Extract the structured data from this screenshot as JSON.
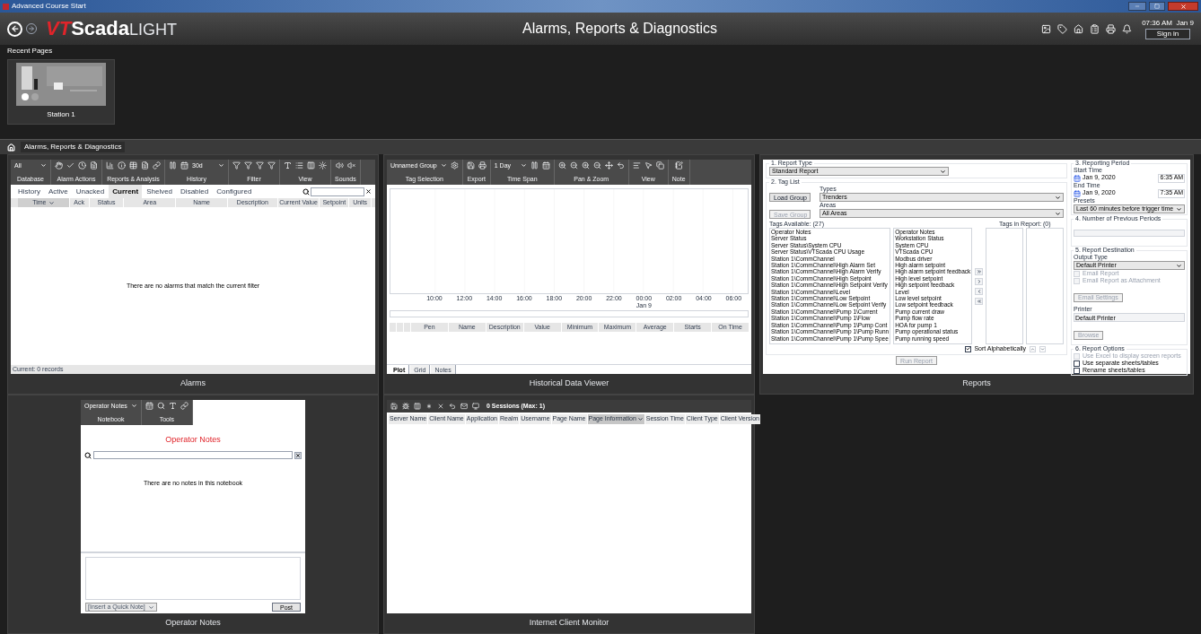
{
  "window": {
    "title": "Advanced Course Start"
  },
  "header": {
    "logo": {
      "brand_red": "VT",
      "brand": "Scada",
      "edition": "LIGHT"
    },
    "title": "Alarms, Reports & Diagnostics",
    "clock": "07:36 AM  Jan 9",
    "sign_in": "Sign in"
  },
  "recent_pages": {
    "title": "Recent Pages",
    "items": [
      {
        "label": "Station 1"
      }
    ]
  },
  "breadcrumb": [
    "Alarms, Reports & Diagnostics"
  ],
  "alarms": {
    "caption": "Alarms",
    "toolbar": [
      {
        "label": "Database",
        "select": "All"
      },
      {
        "label": "Alarm Actions"
      },
      {
        "label": "Reports & Analysis"
      },
      {
        "label": "History",
        "select": "30d"
      },
      {
        "label": "Filter"
      },
      {
        "label": "View"
      },
      {
        "label": "Sounds"
      }
    ],
    "tabs": [
      {
        "label": "History",
        "selected": false
      },
      {
        "label": "Active",
        "selected": false
      },
      {
        "label": "Unacked",
        "selected": false
      },
      {
        "label": "Current",
        "selected": true
      },
      {
        "label": "Shelved",
        "selected": false
      },
      {
        "label": "Disabled",
        "selected": false
      },
      {
        "label": "Configured",
        "selected": false
      }
    ],
    "columns": [
      {
        "label": "Time",
        "sorted": true
      },
      {
        "label": "Ack",
        "sorted": false
      },
      {
        "label": "Status",
        "sorted": false
      },
      {
        "label": "Area",
        "sorted": false
      },
      {
        "label": "Name",
        "sorted": false
      },
      {
        "label": "Description",
        "sorted": false
      },
      {
        "label": "Current Value",
        "sorted": false
      },
      {
        "label": "Setpoint",
        "sorted": false
      },
      {
        "label": "Units",
        "sorted": false
      }
    ],
    "empty_message": "There are no alarms that match the current filter",
    "status": "Current: 0 records"
  },
  "historical": {
    "caption": "Historical Data Viewer",
    "toolbar": [
      {
        "label": "Tag Selection",
        "select": "Unnamed Group"
      },
      {
        "label": "Export"
      },
      {
        "label": "Time Span",
        "select": "1 Day"
      },
      {
        "label": "Pan & Zoom"
      },
      {
        "label": "View"
      },
      {
        "label": "Note"
      }
    ],
    "x_ticks": [
      {
        "label": "10:00"
      },
      {
        "label": "12:00"
      },
      {
        "label": "14:00"
      },
      {
        "label": "16:00"
      },
      {
        "label": "18:00"
      },
      {
        "label": "20:00"
      },
      {
        "label": "22:00"
      },
      {
        "label": "00:00",
        "date": "Jan 9"
      },
      {
        "label": "02:00"
      },
      {
        "label": "04:00"
      },
      {
        "label": "06:00"
      }
    ],
    "columns": [
      "Pen",
      "Name",
      "Description",
      "Value",
      "Minimum",
      "Maximum",
      "Average",
      "Starts",
      "On Time"
    ],
    "tabs": [
      {
        "label": "Plot",
        "selected": true
      },
      {
        "label": "Grid",
        "selected": false
      },
      {
        "label": "Notes",
        "selected": false
      }
    ]
  },
  "reports": {
    "caption": "Reports",
    "report_type": {
      "legend": "1. Report Type",
      "value": "Standard Report"
    },
    "tag_list": {
      "legend": "2. Tag List",
      "buttons": [
        {
          "label": "Load Group",
          "disabled": false
        },
        {
          "label": "Save Group",
          "disabled": true
        }
      ],
      "types_label": "Types",
      "types": "Trenders",
      "areas_label": "Areas",
      "areas": "All Areas",
      "available_label": "Tags Available: (27)",
      "in_report_label": "Tags in Report: (0)",
      "available": [
        {
          "tag": "Operator Notes",
          "description": "Operator Notes"
        },
        {
          "tag": "Server Status",
          "description": "Workstation Status"
        },
        {
          "tag": "Server Status\\System CPU",
          "description": "System CPU"
        },
        {
          "tag": "Server Status\\VTScada CPU Usage",
          "description": "VTScada CPU"
        },
        {
          "tag": "Station 1\\CommChannel",
          "description": "Modbus driver"
        },
        {
          "tag": "Station 1\\CommChannel\\High Alarm Set",
          "description": "High alarm setpoint"
        },
        {
          "tag": "Station 1\\CommChannel\\High Alarm Verify",
          "description": "High alarm setpoint feedback"
        },
        {
          "tag": "Station 1\\CommChannel\\High Setpoint",
          "description": "High level setpoint"
        },
        {
          "tag": "Station 1\\CommChannel\\High Setpoint Verify",
          "description": "High setpoint feedback"
        },
        {
          "tag": "Station 1\\CommChannel\\Level",
          "description": "Level"
        },
        {
          "tag": "Station 1\\CommChannel\\Low Setpoint",
          "description": "Low level setpoint"
        },
        {
          "tag": "Station 1\\CommChannel\\Low Setpoint Verify",
          "description": "Low setpoint feedback"
        },
        {
          "tag": "Station 1\\CommChannel\\Pump 1\\Current",
          "description": "Pump current draw"
        },
        {
          "tag": "Station 1\\CommChannel\\Pump 1\\Flow",
          "description": "Pump flow rate"
        },
        {
          "tag": "Station 1\\CommChannel\\Pump 1\\Pump Cont",
          "description": "HOA for pump 1"
        },
        {
          "tag": "Station 1\\CommChannel\\Pump 1\\Pump Runn",
          "description": "Pump operational status"
        },
        {
          "tag": "Station 1\\CommChannel\\Pump 1\\Pump Spee",
          "description": "Pump running speed"
        }
      ],
      "sort": {
        "label": "Sort Alphabetically",
        "checked": true
      }
    },
    "run_button": {
      "label": "Run Report",
      "disabled": true
    },
    "period": {
      "legend": "3. Reporting Period",
      "start_label": "Start Time",
      "start_date": "Jan 9, 2020",
      "start_time": "6:35 AM",
      "end_label": "End Time",
      "end_date": "Jan 9, 2020",
      "end_time": "7:35 AM",
      "presets_label": "Presets",
      "preset": "Last 60 minutes before trigger time"
    },
    "previous": {
      "legend": "4. Number of Previous Periods"
    },
    "destination": {
      "legend": "5. Report Destination",
      "output_label": "Output Type",
      "output": "Default Printer",
      "checks": [
        {
          "label": "Email Report",
          "checked": false,
          "disabled": true
        },
        {
          "label": "Email Report as Attachment",
          "checked": false,
          "disabled": true
        }
      ],
      "settings_button": {
        "label": "Email Settings",
        "disabled": true
      },
      "printer_label": "Printer",
      "printer": "Default Printer",
      "browse_button": {
        "label": "Browse",
        "disabled": true
      }
    },
    "options": {
      "legend": "6. Report Options",
      "checks": [
        {
          "label": "Use Excel to display screen reports",
          "checked": false,
          "disabled": true
        },
        {
          "label": "Use separate sheets/tables",
          "checked": false,
          "disabled": false
        },
        {
          "label": "Rename sheets/tables",
          "checked": false,
          "disabled": false
        }
      ]
    }
  },
  "notes": {
    "caption": "Operator Notes",
    "toolbar": [
      {
        "label": "Notebook",
        "select": "Operator Notes"
      },
      {
        "label": "Tools"
      }
    ],
    "title": "Operator Notes",
    "empty_message": "There are no notes in this notebook",
    "quick_note": "[Insert a Quick Note]",
    "post": "Post"
  },
  "clients": {
    "caption": "Internet Client Monitor",
    "sessions": "0 Sessions (Max: 1)",
    "columns": [
      {
        "label": "Server Name",
        "selected": false
      },
      {
        "label": "Client Name",
        "selected": false
      },
      {
        "label": "Application",
        "selected": false
      },
      {
        "label": "Realm",
        "selected": false
      },
      {
        "label": "Username",
        "selected": false
      },
      {
        "label": "Page Name",
        "selected": false
      },
      {
        "label": "Page Information",
        "selected": true
      },
      {
        "label": "Session Time",
        "selected": false
      },
      {
        "label": "Client Type",
        "selected": false
      },
      {
        "label": "Client Version",
        "selected": false
      }
    ]
  }
}
